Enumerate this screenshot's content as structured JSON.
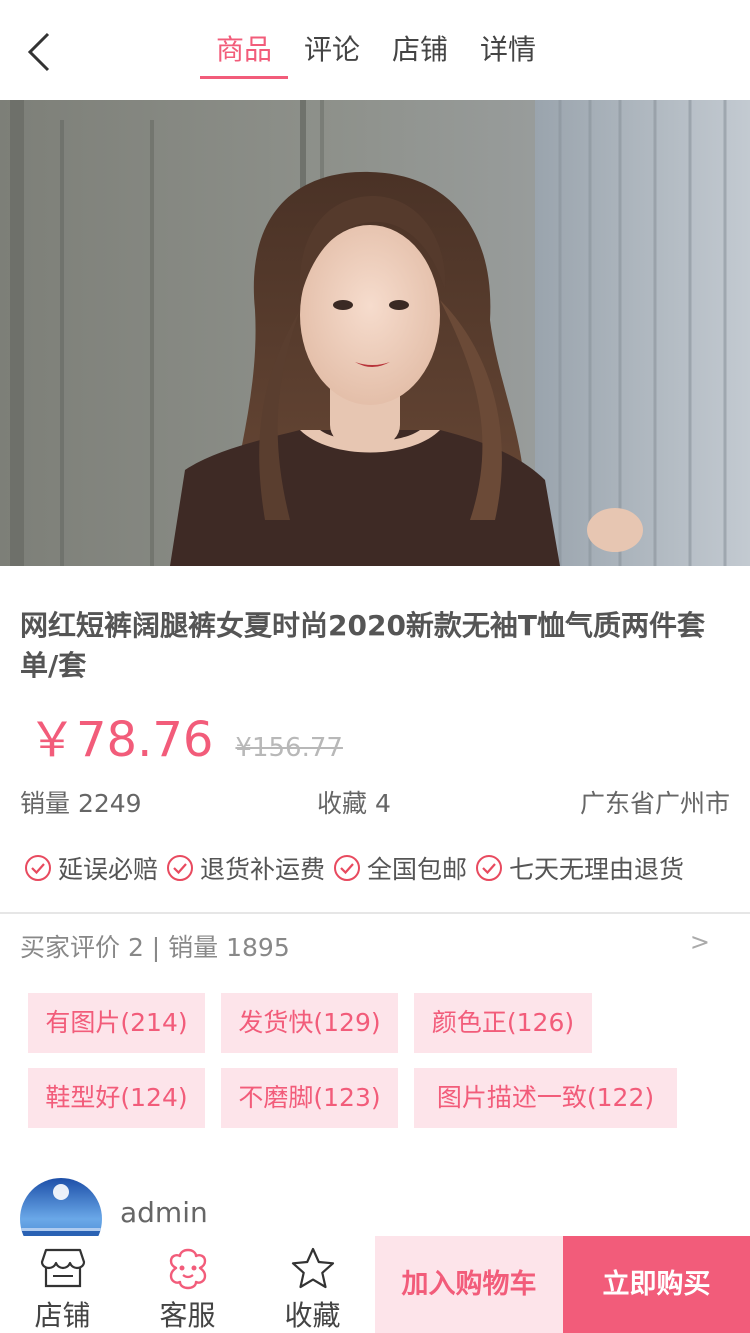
{
  "header": {
    "tabs": [
      {
        "label": "商品"
      },
      {
        "label": "评论"
      },
      {
        "label": "店铺"
      },
      {
        "label": "详情"
      }
    ]
  },
  "product": {
    "title": "网红短裤阔腿裤女夏时尚2020新款无袖T恤气质两件套单/套",
    "price": "￥78.76",
    "original_price": "¥156.77",
    "sales": "销量 2249",
    "favorites": "收藏 4",
    "location": "广东省广州市"
  },
  "guarantees": [
    "延误必赔",
    "退货补运费",
    "全国包邮",
    "七天无理由退货"
  ],
  "reviews": {
    "summary": "买家评价 2 | 销量 1895",
    "more_arrow": ">",
    "tags": [
      "有图片(214)",
      "发货快(129)",
      "颜色正(126)",
      "鞋型好(124)",
      "不磨脚(123)",
      "图片描述一致(122)"
    ],
    "first_reviewer": "admin"
  },
  "bottom_bar": {
    "shop_label": "店铺",
    "service_label": "客服",
    "favorite_label": "收藏",
    "add_cart_label": "加入购物车",
    "buy_now_label": "立即购买"
  },
  "colors": {
    "accent": "#f25c7a",
    "tag_bg": "#fde4ea"
  },
  "icons": [
    "back-arrow-icon",
    "check-circle-icon",
    "store-icon",
    "customer-service-icon",
    "star-icon"
  ]
}
